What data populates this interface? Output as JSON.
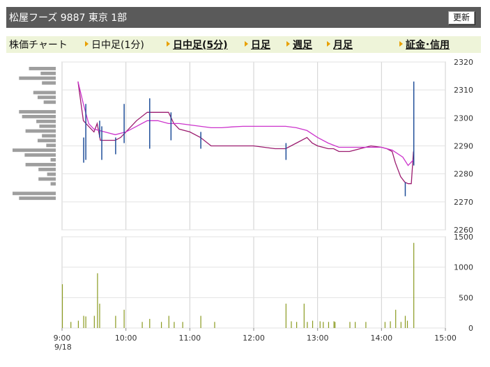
{
  "header": {
    "title": "松屋フーズ 9887 東京 1部",
    "refresh_label": "更新"
  },
  "tabs": [
    {
      "label": "株価チャート"
    },
    {
      "label": "日中足(1分)"
    },
    {
      "label": "日中足(5分)"
    },
    {
      "label": "日足"
    },
    {
      "label": "週足"
    },
    {
      "label": "月足"
    },
    {
      "label": "証金･信用"
    }
  ],
  "colors": {
    "header_bg": "#5a5a5a",
    "tab_bg": "#eef4d9",
    "tab_arrow": "#e8a000",
    "price_bar": "#1f4e99",
    "ma_short": "#9b1b6f",
    "ma_long": "#cc33cc",
    "volume": "#8a9a1f",
    "profile": "#9e9e9e"
  },
  "chart_data": [
    {
      "type": "line",
      "title": "",
      "x_ticks": [
        "9:00",
        "10:00",
        "11:00",
        "12:00",
        "13:00",
        "14:00",
        "15:00"
      ],
      "date_label": "9/18",
      "x_range": [
        "9:00",
        "15:00"
      ],
      "ylim": [
        2260,
        2320
      ],
      "y_ticks": [
        2260,
        2270,
        2280,
        2290,
        2300,
        2310,
        2320
      ],
      "grid": true,
      "price_bars": [
        {
          "x": "9:20",
          "low": 2284,
          "high": 2293
        },
        {
          "x": "9:22",
          "low": 2285,
          "high": 2305
        },
        {
          "x": "9:35",
          "low": 2293,
          "high": 2299
        },
        {
          "x": "9:37",
          "low": 2285,
          "high": 2297
        },
        {
          "x": "9:50",
          "low": 2287,
          "high": 2293
        },
        {
          "x": "9:58",
          "low": 2291,
          "high": 2305
        },
        {
          "x": "10:22",
          "low": 2289,
          "high": 2307
        },
        {
          "x": "10:42",
          "low": 2292,
          "high": 2302
        },
        {
          "x": "11:10",
          "low": 2289,
          "high": 2295
        },
        {
          "x": "12:30",
          "low": 2285,
          "high": 2291
        },
        {
          "x": "14:22",
          "low": 2272,
          "high": 2277
        },
        {
          "x": "14:30",
          "low": 2283,
          "high": 2313
        }
      ],
      "series": [
        {
          "x": [
            "9:15",
            "9:20",
            "9:25",
            "9:30",
            "9:33",
            "9:36",
            "9:40",
            "9:45",
            "9:50",
            "9:55",
            "10:00",
            "10:10",
            "10:20",
            "10:30",
            "10:40",
            "10:45",
            "10:50",
            "11:00",
            "11:10",
            "11:20",
            "11:30",
            "11:40",
            "11:50",
            "12:00",
            "12:10",
            "12:20",
            "12:30",
            "12:40",
            "12:50",
            "12:55",
            "13:00",
            "13:10",
            "13:15",
            "13:20",
            "13:30",
            "13:40",
            "13:50",
            "14:00",
            "14:05",
            "14:10",
            "14:13",
            "14:18",
            "14:22",
            "14:25",
            "14:28",
            "14:30"
          ],
          "values": [
            2313,
            2299,
            2297,
            2295,
            2298,
            2292,
            2292,
            2292,
            2292,
            2293,
            2295,
            2299,
            2302,
            2302,
            2302,
            2298,
            2296,
            2295,
            2293,
            2290,
            2290,
            2290,
            2290,
            2290,
            2289.5,
            2289,
            2289,
            2291,
            2293,
            2291,
            2290,
            2289,
            2289,
            2288,
            2288,
            2289,
            2290,
            2289.5,
            2289,
            2288,
            2284,
            2279,
            2277,
            2276.5,
            2276.5,
            2288
          ]
        },
        {
          "x": [
            "9:15",
            "9:20",
            "9:25",
            "9:30",
            "9:40",
            "9:50",
            "10:00",
            "10:10",
            "10:20",
            "10:30",
            "10:40",
            "10:50",
            "11:00",
            "11:10",
            "11:20",
            "11:30",
            "11:40",
            "11:50",
            "12:00",
            "12:10",
            "12:20",
            "12:30",
            "12:40",
            "12:50",
            "13:00",
            "13:10",
            "13:20",
            "13:30",
            "13:40",
            "13:50",
            "14:00",
            "14:10",
            "14:20",
            "14:25",
            "14:30"
          ],
          "values": [
            2313,
            2305,
            2298,
            2296,
            2295,
            2294,
            2295,
            2297,
            2299,
            2299,
            2298,
            2298,
            2297.5,
            2297,
            2296.5,
            2296.5,
            2296.8,
            2297,
            2297,
            2297,
            2297,
            2297,
            2296.5,
            2295.5,
            2293,
            2291,
            2289.5,
            2289.5,
            2289.5,
            2289.5,
            2289.5,
            2288.5,
            2286,
            2283,
            2285
          ]
        }
      ],
      "volume_profile": [
        0.62,
        0.35,
        0.85,
        0.32,
        0.0,
        0.52,
        0.42,
        0.28,
        0.0,
        0.85,
        0.78,
        0.45,
        0.38,
        0.7,
        0.32,
        0.42,
        0.22,
        1.0,
        0.72,
        0.12,
        0.7,
        0.4,
        0.2,
        0.4,
        0.12,
        0.0,
        1.0,
        0.85,
        0.0
      ]
    },
    {
      "type": "bar",
      "ylim": [
        0,
        1500
      ],
      "y_ticks": [
        0,
        500,
        1000,
        1500
      ],
      "grid": true,
      "x": [
        "9:00",
        "9:08",
        "9:15",
        "9:20",
        "9:22",
        "9:30",
        "9:33",
        "9:35",
        "9:50",
        "9:58",
        "10:15",
        "10:22",
        "10:33",
        "10:40",
        "10:45",
        "10:53",
        "11:10",
        "11:23",
        "12:30",
        "12:35",
        "12:40",
        "12:47",
        "12:50",
        "12:55",
        "13:02",
        "13:05",
        "13:10",
        "13:15",
        "13:16",
        "13:30",
        "13:35",
        "13:45",
        "14:03",
        "14:08",
        "14:13",
        "14:18",
        "14:22",
        "14:24",
        "14:30"
      ],
      "values": [
        720,
        100,
        120,
        200,
        190,
        200,
        900,
        400,
        200,
        300,
        100,
        150,
        100,
        200,
        100,
        100,
        200,
        100,
        400,
        110,
        100,
        400,
        100,
        120,
        110,
        100,
        100,
        110,
        100,
        100,
        100,
        100,
        100,
        110,
        300,
        100,
        200,
        120,
        1400
      ]
    }
  ]
}
